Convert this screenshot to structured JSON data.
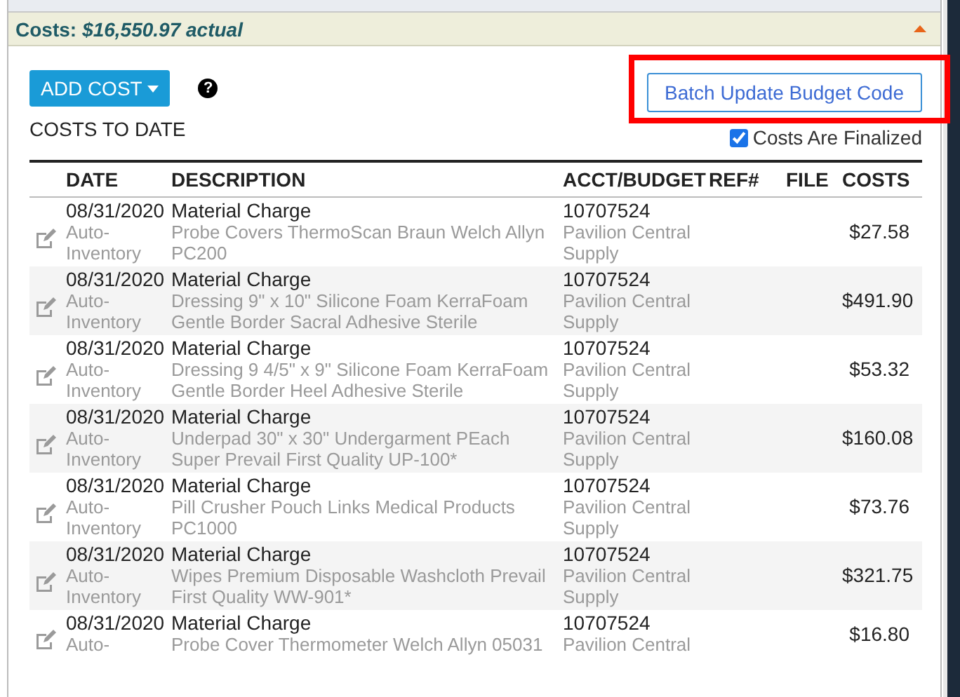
{
  "section": {
    "label": "Costs:",
    "total": "$16,550.97 actual",
    "expanded": true
  },
  "toolbar": {
    "add_button": "ADD COST",
    "help": "?",
    "batch_button": "Batch Update Budget Code",
    "batch_highlighted": true,
    "heading": "COSTS TO DATE",
    "finalized": {
      "label": "Costs Are Finalized",
      "checked": true
    }
  },
  "table": {
    "columns": [
      "DATE",
      "DESCRIPTION",
      "ACCT/BUDGET",
      "REF#",
      "FILE",
      "COSTS"
    ],
    "rows": [
      {
        "date": "08/31/2020",
        "source": "Auto-Inventory",
        "type": "Material Charge",
        "description": "Probe Covers ThermoScan Braun Welch Allyn PC200",
        "acct": "10707524",
        "budget": "Pavilion Central Supply",
        "cost": "$27.58"
      },
      {
        "date": "08/31/2020",
        "source": "Auto-Inventory",
        "type": "Material Charge",
        "description": "Dressing 9\" x 10\" Silicone Foam KerraFoam Gentle Border Sacral Adhesive Sterile",
        "acct": "10707524",
        "budget": "Pavilion Central Supply",
        "cost": "$491.90"
      },
      {
        "date": "08/31/2020",
        "source": "Auto-Inventory",
        "type": "Material Charge",
        "description": "Dressing 9 4/5\" x 9\" Silicone Foam KerraFoam Gentle Border Heel Adhesive Sterile",
        "acct": "10707524",
        "budget": "Pavilion Central Supply",
        "cost": "$53.32"
      },
      {
        "date": "08/31/2020",
        "source": "Auto-Inventory",
        "type": "Material Charge",
        "description": "Underpad 30\" x 30\" Undergarment PEach Super Prevail First Quality UP-100*",
        "acct": "10707524",
        "budget": "Pavilion Central Supply",
        "cost": "$160.08"
      },
      {
        "date": "08/31/2020",
        "source": "Auto-Inventory",
        "type": "Material Charge",
        "description": "Pill Crusher Pouch Links Medical Products PC1000",
        "acct": "10707524",
        "budget": "Pavilion Central Supply",
        "cost": "$73.76"
      },
      {
        "date": "08/31/2020",
        "source": "Auto-Inventory",
        "type": "Material Charge",
        "description": "Wipes Premium Disposable Washcloth Prevail First Quality WW-901*",
        "acct": "10707524",
        "budget": "Pavilion Central Supply",
        "cost": "$321.75"
      },
      {
        "date": "08/31/2020",
        "source": "Auto-",
        "type": "Material Charge",
        "description": "Probe Cover Thermometer Welch Allyn 05031",
        "acct": "10707524",
        "budget": "Pavilion Central",
        "cost": "$16.80"
      }
    ]
  }
}
